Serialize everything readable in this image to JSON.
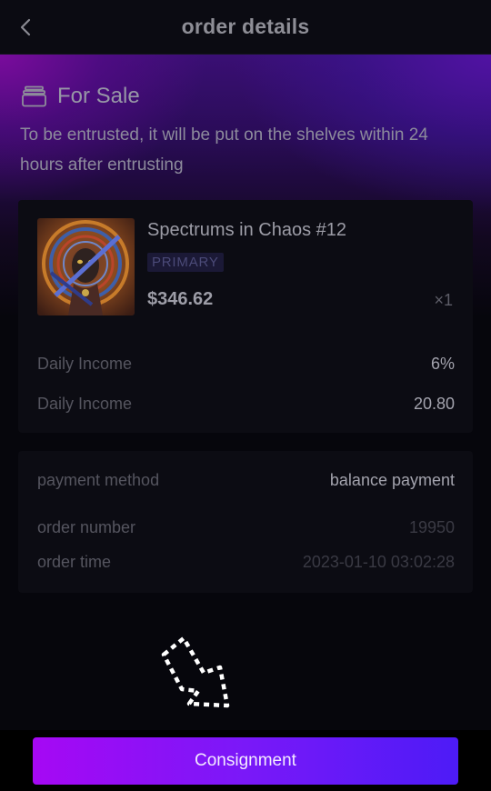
{
  "header": {
    "title": "order details",
    "back_icon": "chevron-left-icon"
  },
  "status": {
    "icon": "wallet-stack-icon",
    "title": "For Sale",
    "description": "To be entrusted, it will be put on the shelves within 24 hours after entrusting"
  },
  "product": {
    "name": "Spectrums in Chaos #12",
    "tag": "PRIMARY",
    "price": "$346.62",
    "quantity": "×1",
    "details": [
      {
        "label": "Daily Income",
        "value": "6%"
      },
      {
        "label": "Daily Income",
        "value": "20.80"
      }
    ]
  },
  "payment": {
    "rows": [
      {
        "label": "payment method",
        "value": "balance payment"
      },
      {
        "label": "order number",
        "value": "19950"
      },
      {
        "label": "order time",
        "value": "2023-01-10 03:02:28"
      }
    ]
  },
  "footer": {
    "button_label": "Consignment",
    "accent_start": "#a608f4",
    "accent_end": "#4d1bf7"
  }
}
